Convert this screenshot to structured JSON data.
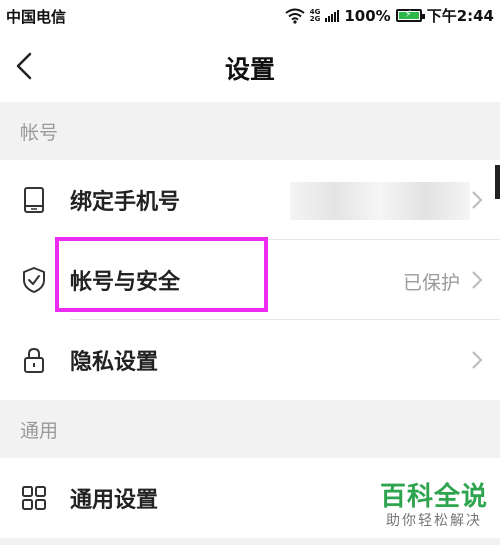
{
  "status_bar": {
    "carrier": "中国电信",
    "network_top": "4G",
    "network_bottom": "2G",
    "battery_percent": "100%",
    "time": "下午2:44",
    "icons": [
      "wifi-icon",
      "signal-icon",
      "battery-icon"
    ]
  },
  "header": {
    "title": "设置",
    "back_icon": "chevron-left-icon"
  },
  "sections": [
    {
      "title": "帐号",
      "items": [
        {
          "label": "绑定手机号",
          "value": "",
          "icon": "phone-icon"
        },
        {
          "label": "帐号与安全",
          "value": "已保护",
          "icon": "shield-check-icon"
        },
        {
          "label": "隐私设置",
          "value": "",
          "icon": "lock-icon"
        }
      ]
    },
    {
      "title": "通用",
      "items": [
        {
          "label": "通用设置",
          "value": "",
          "icon": "grid-icon"
        }
      ]
    }
  ],
  "watermark": {
    "brand": "百科全说",
    "tagline": "助你轻松解决"
  },
  "colors": {
    "highlight": "#ee2cf0",
    "watermark_green": "#2ea44f",
    "muted_text": "#9a9a9a",
    "background": "#f2f2f2"
  }
}
